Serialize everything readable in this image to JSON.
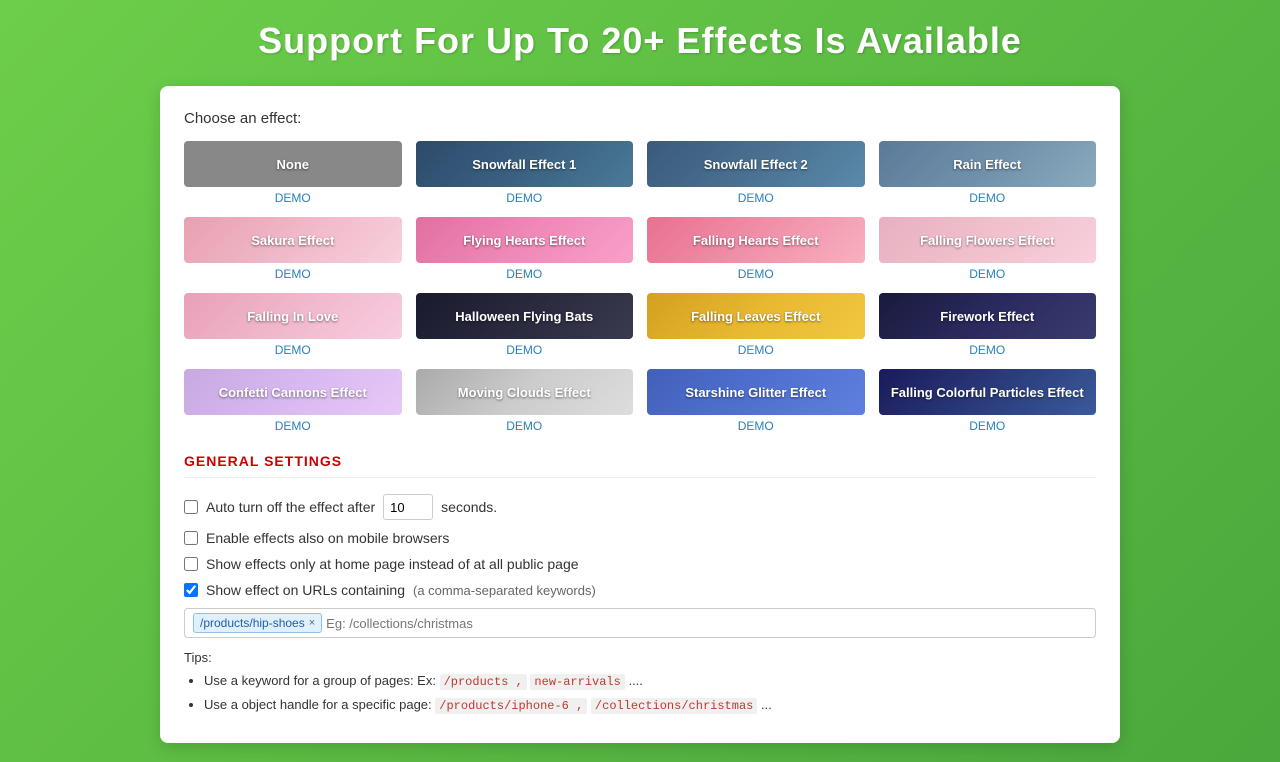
{
  "page": {
    "title": "Support For Up To 20+ Effects Is Available"
  },
  "chooser": {
    "label": "Choose an effect:"
  },
  "effects": [
    {
      "id": "none",
      "label": "None",
      "style": "none-btn",
      "demo": true
    },
    {
      "id": "snowfall1",
      "label": "Snowfall Effect 1",
      "style": "snowfall1",
      "demo": true
    },
    {
      "id": "snowfall2",
      "label": "Snowfall Effect 2",
      "style": "snowfall2",
      "demo": true
    },
    {
      "id": "rain",
      "label": "Rain Effect",
      "style": "rain",
      "demo": true
    },
    {
      "id": "sakura",
      "label": "Sakura Effect",
      "style": "sakura",
      "demo": true
    },
    {
      "id": "flying-hearts",
      "label": "Flying Hearts Effect",
      "style": "flying-hearts",
      "demo": true
    },
    {
      "id": "falling-hearts",
      "label": "Falling Hearts Effect",
      "style": "falling-hearts",
      "demo": true
    },
    {
      "id": "falling-flowers",
      "label": "Falling Flowers Effect",
      "style": "falling-flowers",
      "demo": true
    },
    {
      "id": "falling-in-love",
      "label": "Falling In Love",
      "style": "falling-in-love",
      "demo": true
    },
    {
      "id": "halloween",
      "label": "Halloween Flying Bats",
      "style": "halloween",
      "demo": true
    },
    {
      "id": "falling-leaves",
      "label": "Falling Leaves Effect",
      "style": "falling-leaves",
      "demo": true
    },
    {
      "id": "firework",
      "label": "Firework Effect",
      "style": "firework",
      "demo": true
    },
    {
      "id": "confetti",
      "label": "Confetti Cannons Effect",
      "style": "confetti",
      "demo": true
    },
    {
      "id": "moving-clouds",
      "label": "Moving Clouds Effect",
      "style": "moving-clouds",
      "demo": true
    },
    {
      "id": "starshine",
      "label": "Starshine Glitter Effect",
      "style": "starshine",
      "demo": true
    },
    {
      "id": "falling-colorful",
      "label": "Falling Colorful Particles Effect",
      "style": "falling-colorful",
      "demo": true
    }
  ],
  "demo_label": "DEMO",
  "general_settings": {
    "title": "GENERAL SETTINGS",
    "auto_turn_off_label": "Auto turn off the effect after",
    "auto_turn_off_value": "10",
    "auto_turn_off_suffix": "seconds.",
    "mobile_label": "Enable effects also on mobile browsers",
    "homepage_label": "Show effects only at home page instead of at all public page",
    "url_label": "Show effect on URLs containing",
    "url_hint": "(a comma-separated keywords)",
    "url_tag": "/products/hip-shoes",
    "url_placeholder": "Eg: /collections/christmas"
  },
  "tips": {
    "title": "Tips:",
    "items": [
      {
        "text_before": "Use a keyword for a group of pages: Ex: ",
        "code1": "/products ,",
        "code2": "new-arrivals",
        "text_after": "...."
      },
      {
        "text_before": "Use a object handle for a specific page: ",
        "code1": "/products/iphone-6 ,",
        "code2": "/collections/christmas",
        "text_after": "..."
      }
    ]
  }
}
